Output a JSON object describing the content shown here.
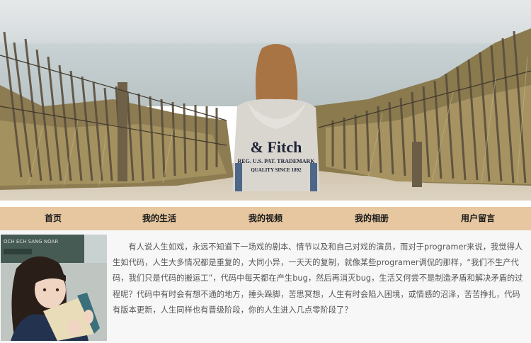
{
  "banner": {
    "hoodie_text_line1": "& Fitch",
    "hoodie_text_line2": "REG. U.S. PAT. TRADEMARK",
    "hoodie_text_line3": "QUALITY SINCE 1892"
  },
  "nav": {
    "items": [
      {
        "label": "首页"
      },
      {
        "label": "我的生活"
      },
      {
        "label": "我的视频"
      },
      {
        "label": "我的相册"
      },
      {
        "label": "用户留言"
      }
    ]
  },
  "photo": {
    "sign_text": "OCH ECH SANG NOAR"
  },
  "intro": {
    "text": "有人说人生如戏，永远不知道下一场戏的剧本、情节以及和自己对戏的演员，而对于programer来说，我觉得人生如代码，人生大多情况都是重复的，大同小异，一天天的复制，就像某些programer调侃的那样，“我们不生产代码，我们只是代码的搬运工”，代码中每天都在产生bug，然后再消灭bug，生活又何尝不是制造矛盾和解决矛盾的过程呢？代码中有时会有想不通的地方，捶头跺脚，苦思冥想，人生有时会陷入困境，或情感的沼泽，苦苦挣扎，代码有版本更新，人生同样也有晋级阶段，你的人生进入几点零阶段了？"
  },
  "colors": {
    "nav_bg": "#e6c7a0",
    "content_bg": "#f7f7f7",
    "text": "#555555"
  }
}
